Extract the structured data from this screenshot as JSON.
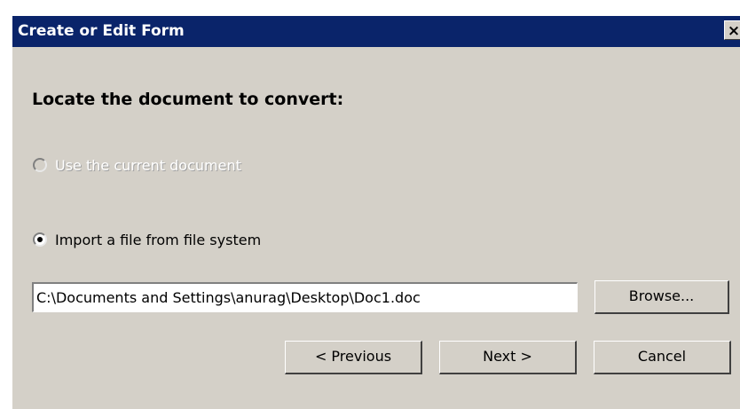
{
  "dialog": {
    "title": "Create or Edit Form",
    "close_glyph": "×",
    "heading": "Locate the document to convert:",
    "options": [
      {
        "label": "Use the current document",
        "selected": false,
        "enabled": false
      },
      {
        "label": "Import a file from file system",
        "selected": true,
        "enabled": true
      }
    ],
    "file_path_value": "C:\\Documents and Settings\\anurag\\Desktop\\Doc1.doc",
    "buttons": {
      "browse": "Browse...",
      "previous": "< Previous",
      "next": "Next >",
      "cancel": "Cancel"
    }
  },
  "colors": {
    "titlebar": "#0a246a",
    "dialog_bg": "#d4d0c8"
  }
}
